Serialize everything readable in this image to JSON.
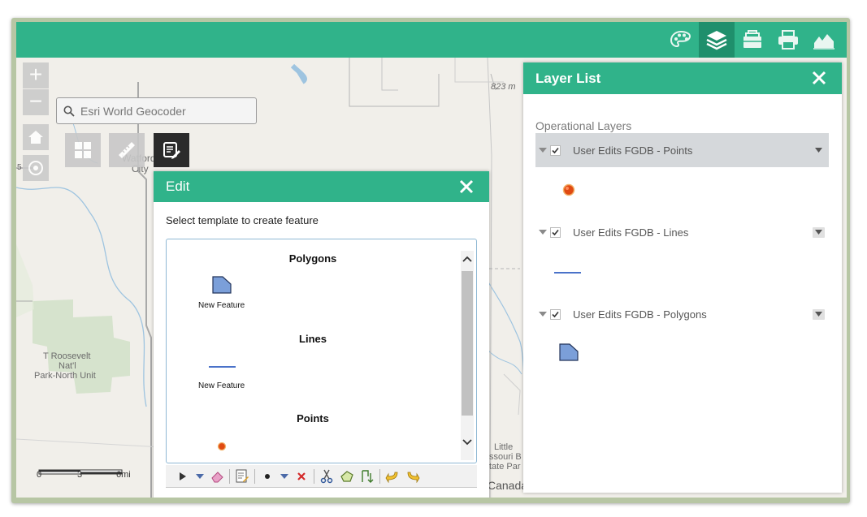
{
  "map": {
    "labels": {
      "elevation": "823 m",
      "watford": "Watford",
      "city": "City",
      "park_line1": "T Roosevelt",
      "park_line2": "Nat'l",
      "park_line3": "Park-North Unit",
      "little_missouri_line1": "Little",
      "little_missouri_line2": "ssouri B",
      "little_missouri_line3": "tate Par",
      "canada": "Canada",
      "edge_number": "5"
    },
    "scalebar": {
      "ticks": [
        "0",
        "3",
        "6mi"
      ]
    },
    "zoom_in": "+",
    "zoom_out": "−"
  },
  "search": {
    "placeholder": "Esri World Geocoder"
  },
  "topbar": {
    "icons": [
      "palette-icon",
      "layers-icon",
      "basemap-gallery-icon",
      "print-icon",
      "elevation-profile-icon"
    ],
    "active": "layers-icon"
  },
  "edit": {
    "title": "Edit",
    "instructions": "Select template to create feature",
    "groups": [
      {
        "heading": "Polygons",
        "item_label": "New Feature"
      },
      {
        "heading": "Lines",
        "item_label": "New Feature"
      },
      {
        "heading": "Points"
      }
    ]
  },
  "layer_list": {
    "title": "Layer List",
    "section": "Operational Layers",
    "layers": [
      {
        "title": "User Edits FGDB - Points",
        "checked": true,
        "selected": true
      },
      {
        "title": "User Edits FGDB - Lines",
        "checked": true,
        "selected": false
      },
      {
        "title": "User Edits FGDB - Polygons",
        "checked": true,
        "selected": false
      }
    ]
  },
  "colors": {
    "accent": "#30b38a",
    "accent_dark": "#1f8f6c",
    "polygon_fill": "#7b9fd9",
    "line_stroke": "#4a72c9",
    "point_fill": "#e04a12"
  }
}
